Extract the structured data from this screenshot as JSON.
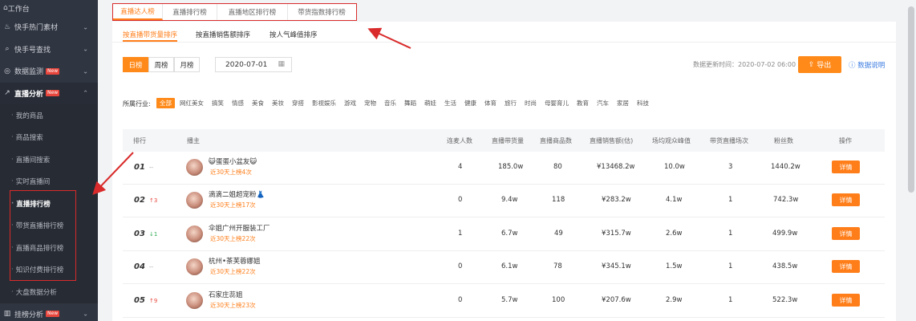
{
  "sidebar": {
    "top": {
      "label": "工作台",
      "icon": "home-icon"
    },
    "groups": [
      {
        "label": "快手热门素材",
        "icon": "fire-icon"
      },
      {
        "label": "快手号查找",
        "icon": "search-icon"
      },
      {
        "label": "数据监测",
        "icon": "monitor-icon",
        "badge": "New"
      },
      {
        "label": "直播分析",
        "icon": "trend-icon",
        "badge": "New"
      }
    ],
    "sub_items": [
      {
        "label": "我的商品"
      },
      {
        "label": "商品搜索"
      },
      {
        "label": "直播间搜索"
      },
      {
        "label": "实时直播间"
      },
      {
        "label": "直播排行榜"
      },
      {
        "label": "带货直播排行榜"
      },
      {
        "label": "直播商品排行榜"
      },
      {
        "label": "知识付费排行榜"
      },
      {
        "label": "大盘数据分析"
      }
    ],
    "bottom": {
      "label": "挂榜分析",
      "badge": "New"
    }
  },
  "top_tabs": [
    "直播达人榜",
    "直播排行榜",
    "直播地区排行榜",
    "带货指数排行榜"
  ],
  "sub_tabs": [
    "按直播带货量排序",
    "按直播销售额排序",
    "按人气峰值排序"
  ],
  "period": [
    "日榜",
    "周榜",
    "月榜"
  ],
  "date_value": "2020-07-01",
  "update_time": "数据更新时间：2020-07-02 06:00",
  "export_label": "导出",
  "help_label": "数据说明",
  "industry": {
    "label": "所属行业:",
    "items": [
      "全部",
      "网红美女",
      "搞笑",
      "情感",
      "美食",
      "美妆",
      "穿搭",
      "影视娱乐",
      "游戏",
      "宠物",
      "音乐",
      "舞蹈",
      "萌娃",
      "生活",
      "健康",
      "体育",
      "旅行",
      "时尚",
      "母婴育儿",
      "教育",
      "汽车",
      "家居",
      "科技"
    ]
  },
  "table": {
    "headers": [
      "排行",
      "播主",
      "连麦人数",
      "直播带货量",
      "直播商品数",
      "直播销售额(估)",
      "场均观众峰值",
      "带货直播场次",
      "粉丝数",
      "操作"
    ],
    "rows": [
      {
        "rank": "01",
        "change": "--",
        "dir": "none",
        "name": "😺蛋蛋小盆友😺",
        "sub": "近30天上榜4次",
        "lianmai": "4",
        "volume": "185.0w",
        "goods": "80",
        "sales": "¥13468.2w",
        "peak": "10.0w",
        "sessions": "3",
        "fans": "1440.2w",
        "action": "详情"
      },
      {
        "rank": "02",
        "change": "↑3",
        "dir": "up",
        "name": "滴滴二姐超宠粉👗",
        "sub": "近30天上榜17次",
        "lianmai": "0",
        "volume": "9.4w",
        "goods": "118",
        "sales": "¥283.2w",
        "peak": "4.1w",
        "sessions": "1",
        "fans": "742.3w",
        "action": "详情"
      },
      {
        "rank": "03",
        "change": "↓1",
        "dir": "down",
        "name": "伞姐广州开服装工厂",
        "sub": "近30天上榜22次",
        "lianmai": "1",
        "volume": "6.7w",
        "goods": "49",
        "sales": "¥315.7w",
        "peak": "2.6w",
        "sessions": "1",
        "fans": "499.9w",
        "action": "详情"
      },
      {
        "rank": "04",
        "change": "--",
        "dir": "none",
        "name": "杭州•茶芙蓉娜姐",
        "sub": "近30天上榜22次",
        "lianmai": "0",
        "volume": "6.1w",
        "goods": "78",
        "sales": "¥345.1w",
        "peak": "1.5w",
        "sessions": "1",
        "fans": "438.5w",
        "action": "详情"
      },
      {
        "rank": "05",
        "change": "↑9",
        "dir": "up",
        "name": "石家庄蕊姐",
        "sub": "近30天上榜23次",
        "lianmai": "0",
        "volume": "5.7w",
        "goods": "100",
        "sales": "¥207.6w",
        "peak": "2.9w",
        "sessions": "1",
        "fans": "522.3w",
        "action": "详情"
      }
    ]
  },
  "colors": {
    "accent": "#ff7e1a",
    "sidebar_bg": "#2f3541",
    "annotation": "#d92b2b",
    "link": "#3a7be0"
  }
}
